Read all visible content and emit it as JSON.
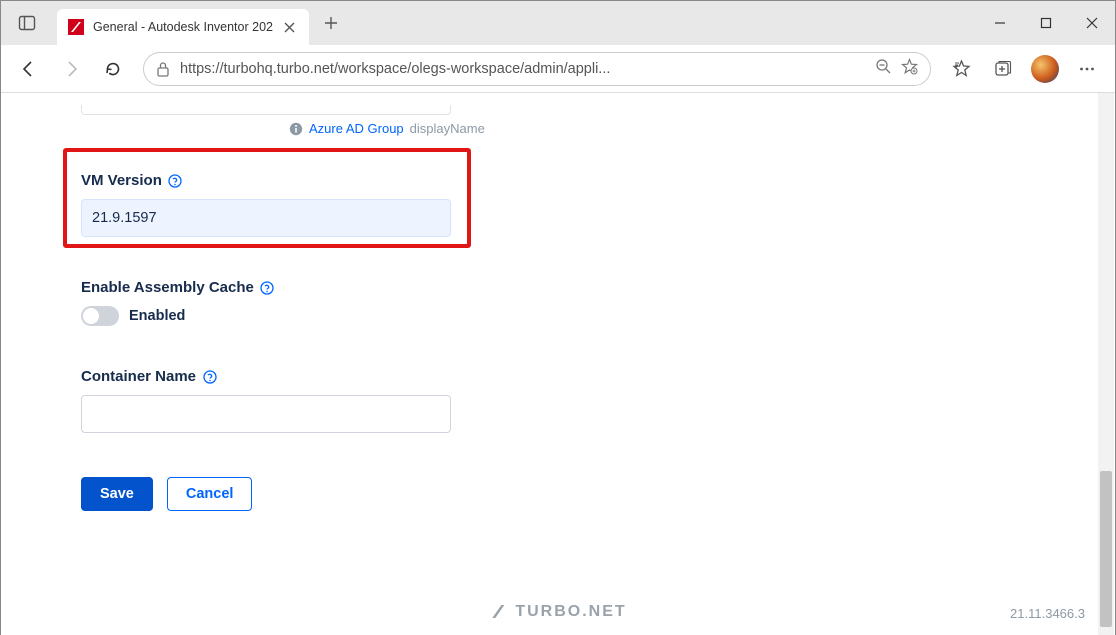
{
  "browser": {
    "tab_title": "General - Autodesk Inventor 202",
    "url_display": "https://turbohq.turbo.net/workspace/olegs-workspace/admin/appli..."
  },
  "topHint": {
    "link_text": "Azure AD Group",
    "suffix": "displayName"
  },
  "vmVersion": {
    "label": "VM Version",
    "value": "21.9.1597"
  },
  "assemblyCache": {
    "label": "Enable Assembly Cache",
    "toggle_label": "Enabled"
  },
  "containerName": {
    "label": "Container Name",
    "value": ""
  },
  "buttons": {
    "save": "Save",
    "cancel": "Cancel"
  },
  "footer": {
    "brand": "TURBO.NET",
    "build": "21.11.3466.3"
  }
}
